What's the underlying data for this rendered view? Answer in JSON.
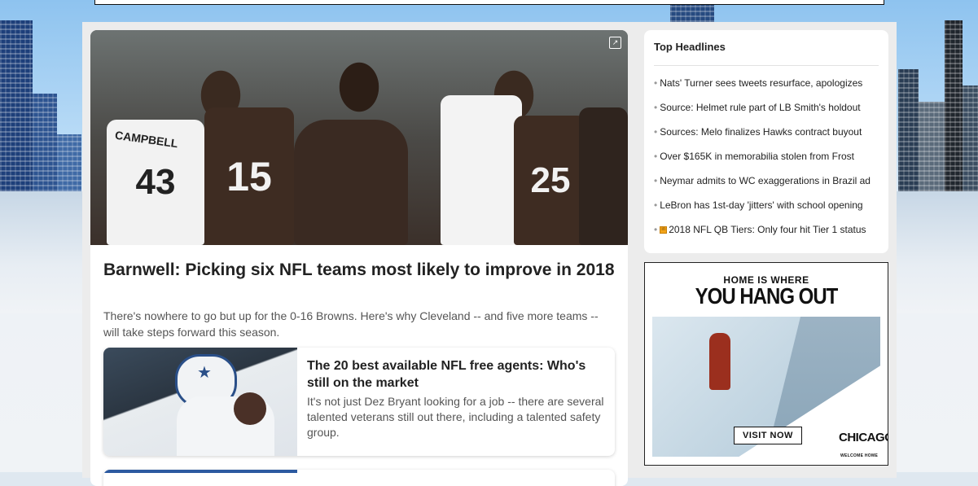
{
  "hero": {
    "title": "Barnwell: Picking six NFL teams most likely to improve in 2018",
    "description": "There's nowhere to go but up for the 0-16 Browns. Here's why Cleveland -- and five more teams -- will take steps forward this season.",
    "jerseys": [
      "43",
      "15",
      "25"
    ],
    "name_bar": "CAMPBELL"
  },
  "secondary_story": {
    "title": "The 20 best available NFL free agents: Who's still on the market",
    "description": "It's not just Dez Bryant looking for a job -- there are several talented veterans still out there, including a talented safety group."
  },
  "top_headlines": {
    "heading": "Top Headlines",
    "items": [
      {
        "text": "Nats' Turner sees tweets resurface, apologizes",
        "insider": false
      },
      {
        "text": "Source: Helmet rule part of LB Smith's holdout",
        "insider": false
      },
      {
        "text": "Sources: Melo finalizes Hawks contract buyout",
        "insider": false
      },
      {
        "text": "Over $165K in memorabilia stolen from Frost",
        "insider": false
      },
      {
        "text": "Neymar admits to WC exaggerations in Brazil ad",
        "insider": false
      },
      {
        "text": "LeBron has 1st-day 'jitters' with school opening",
        "insider": false
      },
      {
        "text": "2018 NFL QB Tiers: Only four hit Tier 1 status",
        "insider": true
      }
    ]
  },
  "ad": {
    "line1": "HOME IS WHERE",
    "line2": "YOU HANG OUT",
    "cta": "VISIT NOW",
    "logo": "CHICAGO",
    "logo_tagline": "WELCOME HOME"
  }
}
